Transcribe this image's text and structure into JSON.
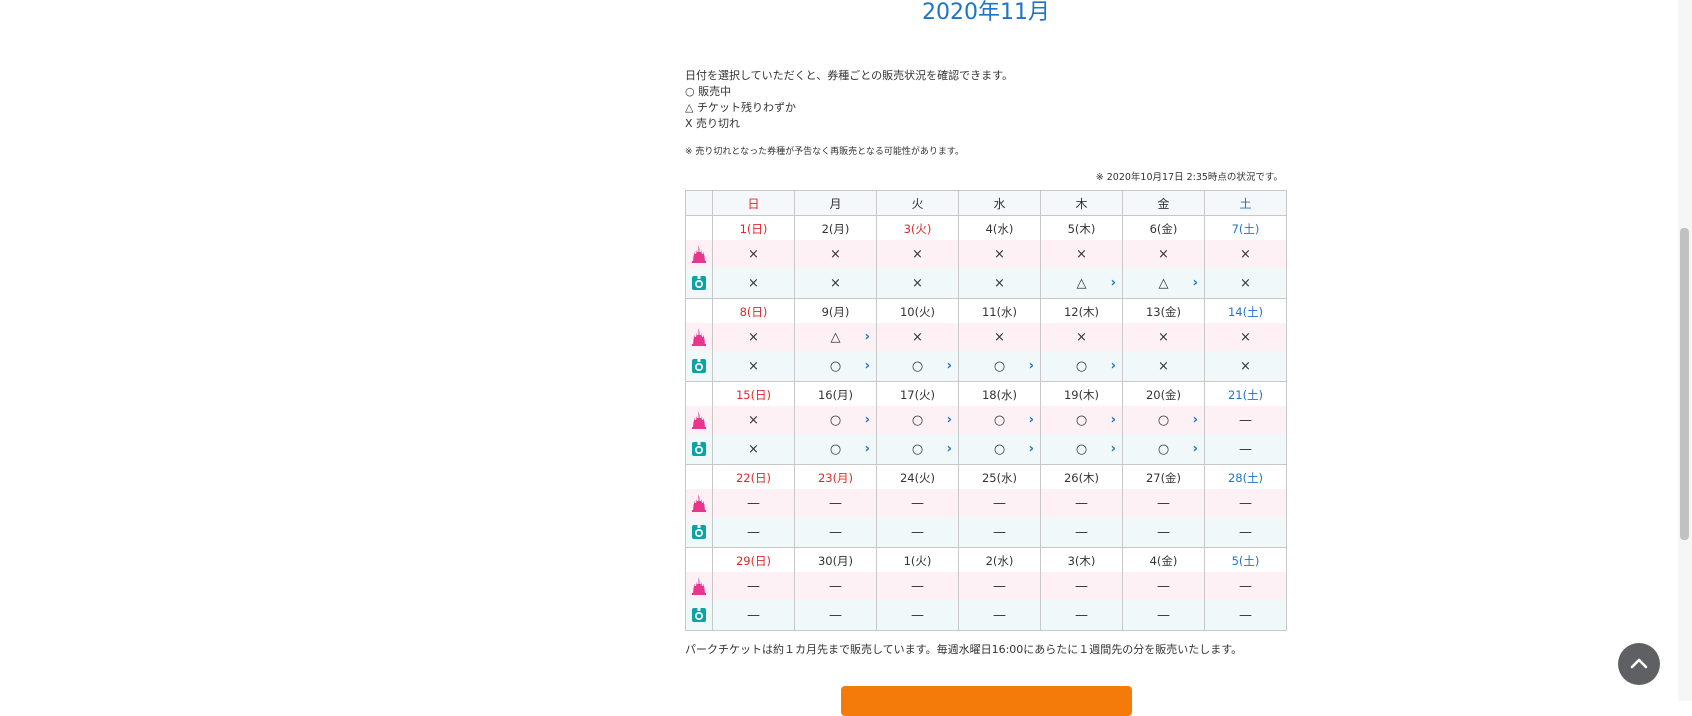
{
  "title": "2020年11月",
  "intro": {
    "line1": "日付を選択していただくと、券種ごとの販売状況を確認できます。",
    "legend_available": "○ 販売中",
    "legend_few": "△ チケット残りわずか",
    "legend_soldout": "X 売り切れ"
  },
  "note_resale": "※ 売り切れとなった券種が予告なく再販売となる可能性があります。",
  "note_time": "※ 2020年10月17日 2:35時点の状況です。",
  "weekdays": [
    "日",
    "月",
    "火",
    "水",
    "木",
    "金",
    "土"
  ],
  "weeks": [
    {
      "dates": [
        "1(日)",
        "2(月)",
        "3(火)",
        "4(水)",
        "5(木)",
        "6(金)",
        "7(土)"
      ],
      "holiday": [
        true,
        false,
        true,
        false,
        false,
        false,
        false
      ],
      "land": [
        "×",
        "×",
        "×",
        "×",
        "×",
        "×",
        "×"
      ],
      "land_arrow": [
        false,
        false,
        false,
        false,
        false,
        false,
        false
      ],
      "sea": [
        "×",
        "×",
        "×",
        "×",
        "△",
        "△",
        "×"
      ],
      "sea_arrow": [
        false,
        false,
        false,
        false,
        true,
        true,
        false
      ]
    },
    {
      "dates": [
        "8(日)",
        "9(月)",
        "10(火)",
        "11(水)",
        "12(木)",
        "13(金)",
        "14(土)"
      ],
      "holiday": [
        true,
        false,
        false,
        false,
        false,
        false,
        false
      ],
      "land": [
        "×",
        "△",
        "×",
        "×",
        "×",
        "×",
        "×"
      ],
      "land_arrow": [
        false,
        true,
        false,
        false,
        false,
        false,
        false
      ],
      "sea": [
        "×",
        "○",
        "○",
        "○",
        "○",
        "×",
        "×"
      ],
      "sea_arrow": [
        false,
        true,
        true,
        true,
        true,
        false,
        false
      ]
    },
    {
      "dates": [
        "15(日)",
        "16(月)",
        "17(火)",
        "18(水)",
        "19(木)",
        "20(金)",
        "21(土)"
      ],
      "holiday": [
        true,
        false,
        false,
        false,
        false,
        false,
        false
      ],
      "land": [
        "×",
        "○",
        "○",
        "○",
        "○",
        "○",
        "—"
      ],
      "land_arrow": [
        false,
        true,
        true,
        true,
        true,
        true,
        false
      ],
      "sea": [
        "×",
        "○",
        "○",
        "○",
        "○",
        "○",
        "—"
      ],
      "sea_arrow": [
        false,
        true,
        true,
        true,
        true,
        true,
        false
      ]
    },
    {
      "dates": [
        "22(日)",
        "23(月)",
        "24(火)",
        "25(水)",
        "26(木)",
        "27(金)",
        "28(土)"
      ],
      "holiday": [
        true,
        true,
        false,
        false,
        false,
        false,
        false
      ],
      "land": [
        "—",
        "—",
        "—",
        "—",
        "—",
        "—",
        "—"
      ],
      "land_arrow": [
        false,
        false,
        false,
        false,
        false,
        false,
        false
      ],
      "sea": [
        "—",
        "—",
        "—",
        "—",
        "—",
        "—",
        "—"
      ],
      "sea_arrow": [
        false,
        false,
        false,
        false,
        false,
        false,
        false
      ]
    },
    {
      "dates": [
        "29(日)",
        "30(月)",
        "1(火)",
        "2(水)",
        "3(木)",
        "4(金)",
        "5(土)"
      ],
      "holiday": [
        true,
        false,
        false,
        false,
        false,
        false,
        false
      ],
      "land": [
        "—",
        "—",
        "—",
        "—",
        "—",
        "—",
        "—"
      ],
      "land_arrow": [
        false,
        false,
        false,
        false,
        false,
        false,
        false
      ],
      "sea": [
        "—",
        "—",
        "—",
        "—",
        "—",
        "—",
        "—"
      ],
      "sea_arrow": [
        false,
        false,
        false,
        false,
        false,
        false,
        false
      ]
    }
  ],
  "footer_note": "パークチケットは約１カ月先まで販売しています。毎週水曜日16:00にあらたに１週間先の分を販売いたします。",
  "icons": {
    "land": "castle-icon",
    "sea": "globe-icon",
    "arrow": "chevron-right-icon",
    "top": "chevron-up-icon"
  },
  "colors": {
    "sunday": "#e02828",
    "saturday": "#1e74c6",
    "land_bg": "#fdf1f5",
    "sea_bg": "#f1f8f9",
    "land_icon": "#e8368f",
    "sea_icon": "#0aa3a6",
    "button": "#f47a0a"
  }
}
